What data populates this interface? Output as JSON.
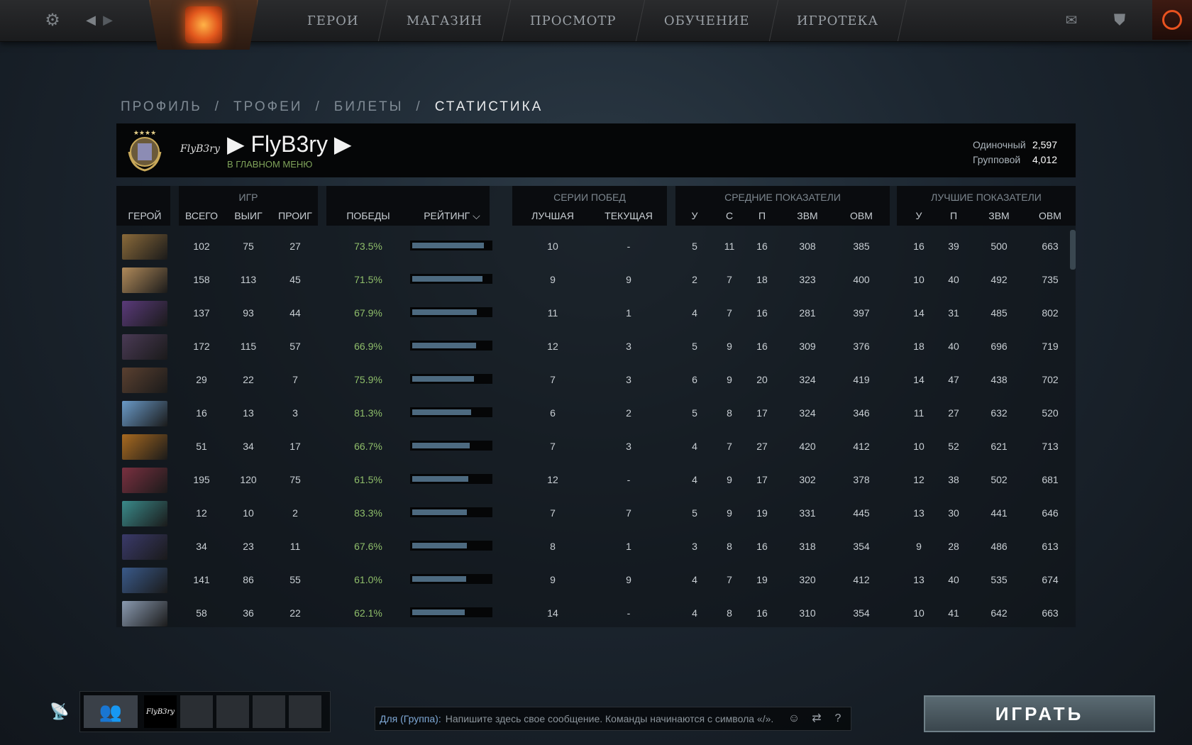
{
  "nav": {
    "items": [
      "ГЕРОИ",
      "МАГАЗИН",
      "ПРОСМОТР",
      "ОБУЧЕНИЕ",
      "ИГРОТЕКА"
    ]
  },
  "breadcrumb": {
    "items": [
      "ПРОФИЛЬ",
      "ТРОФЕИ",
      "БИЛЕТЫ",
      "СТАТИСТИКА"
    ],
    "separator": "/",
    "active": "СТАТИСТИКА"
  },
  "profile": {
    "avatar_text": "FlyB3ry",
    "name": "▶ FlyB3ry ▶",
    "status": "В ГЛАВНОМ МЕНЮ",
    "mmr": [
      {
        "label": "Одиночный",
        "value": "2,597"
      },
      {
        "label": "Групповой",
        "value": "4,012"
      }
    ]
  },
  "table": {
    "groups": {
      "games": "ИГР",
      "streaks": "СЕРИИ ПОБЕД",
      "avg": "СРЕДНИЕ ПОКАЗАТЕЛИ",
      "best": "ЛУЧШИЕ ПОКАЗАТЕЛИ"
    },
    "columns": {
      "hero": "ГЕРОЙ",
      "total": "ВСЕГО",
      "won": "ВЫИГ",
      "lost": "ПРОИГ",
      "winrate": "ПОБЕДЫ",
      "rating": "РЕЙТИНГ ⌵",
      "best_streak": "ЛУЧШАЯ",
      "cur_streak": "ТЕКУЩАЯ",
      "avg_k": "У",
      "avg_d": "С",
      "avg_a": "П",
      "avg_xpm": "ЗВМ",
      "avg_gpm": "ОВМ",
      "best_k": "У",
      "best_a": "П",
      "best_xpm": "ЗВМ",
      "best_gpm": "ОВМ"
    },
    "rows": [
      {
        "hero_color": "#8a6a3a",
        "total": "102",
        "won": "75",
        "lost": "27",
        "winrate": "73.5%",
        "rating": 0.92,
        "best_streak": "10",
        "cur_streak": "-",
        "avg": [
          "5",
          "11",
          "16",
          "308",
          "385"
        ],
        "best": [
          "16",
          "39",
          "500",
          "663"
        ]
      },
      {
        "hero_color": "#b08a5a",
        "total": "158",
        "won": "113",
        "lost": "45",
        "winrate": "71.5%",
        "rating": 0.9,
        "best_streak": "9",
        "cur_streak": "9",
        "avg": [
          "2",
          "7",
          "18",
          "323",
          "400"
        ],
        "best": [
          "10",
          "40",
          "492",
          "735"
        ]
      },
      {
        "hero_color": "#5a3a7a",
        "total": "137",
        "won": "93",
        "lost": "44",
        "winrate": "67.9%",
        "rating": 0.83,
        "best_streak": "11",
        "cur_streak": "1",
        "avg": [
          "4",
          "7",
          "16",
          "281",
          "397"
        ],
        "best": [
          "14",
          "31",
          "485",
          "802"
        ]
      },
      {
        "hero_color": "#4a3a55",
        "total": "172",
        "won": "115",
        "lost": "57",
        "winrate": "66.9%",
        "rating": 0.82,
        "best_streak": "12",
        "cur_streak": "3",
        "avg": [
          "5",
          "9",
          "16",
          "309",
          "376"
        ],
        "best": [
          "18",
          "40",
          "696",
          "719"
        ]
      },
      {
        "hero_color": "#5a4030",
        "total": "29",
        "won": "22",
        "lost": "7",
        "winrate": "75.9%",
        "rating": 0.79,
        "best_streak": "7",
        "cur_streak": "3",
        "avg": [
          "6",
          "9",
          "20",
          "324",
          "419"
        ],
        "best": [
          "14",
          "47",
          "438",
          "702"
        ]
      },
      {
        "hero_color": "#6a9ac8",
        "total": "16",
        "won": "13",
        "lost": "3",
        "winrate": "81.3%",
        "rating": 0.75,
        "best_streak": "6",
        "cur_streak": "2",
        "avg": [
          "5",
          "8",
          "17",
          "324",
          "346"
        ],
        "best": [
          "11",
          "27",
          "632",
          "520"
        ]
      },
      {
        "hero_color": "#a86a20",
        "total": "51",
        "won": "34",
        "lost": "17",
        "winrate": "66.7%",
        "rating": 0.74,
        "best_streak": "7",
        "cur_streak": "3",
        "avg": [
          "4",
          "7",
          "27",
          "420",
          "412"
        ],
        "best": [
          "10",
          "52",
          "621",
          "713"
        ]
      },
      {
        "hero_color": "#7a3040",
        "total": "195",
        "won": "120",
        "lost": "75",
        "winrate": "61.5%",
        "rating": 0.72,
        "best_streak": "12",
        "cur_streak": "-",
        "avg": [
          "4",
          "9",
          "17",
          "302",
          "378"
        ],
        "best": [
          "12",
          "38",
          "502",
          "681"
        ]
      },
      {
        "hero_color": "#3a8a8a",
        "total": "12",
        "won": "10",
        "lost": "2",
        "winrate": "83.3%",
        "rating": 0.7,
        "best_streak": "7",
        "cur_streak": "7",
        "avg": [
          "5",
          "9",
          "19",
          "331",
          "445"
        ],
        "best": [
          "13",
          "30",
          "441",
          "646"
        ]
      },
      {
        "hero_color": "#3a3a6a",
        "total": "34",
        "won": "23",
        "lost": "11",
        "winrate": "67.6%",
        "rating": 0.7,
        "best_streak": "8",
        "cur_streak": "1",
        "avg": [
          "3",
          "8",
          "16",
          "318",
          "354"
        ],
        "best": [
          "9",
          "28",
          "486",
          "613"
        ]
      },
      {
        "hero_color": "#3a5a8a",
        "total": "141",
        "won": "86",
        "lost": "55",
        "winrate": "61.0%",
        "rating": 0.69,
        "best_streak": "9",
        "cur_streak": "9",
        "avg": [
          "4",
          "7",
          "19",
          "320",
          "412"
        ],
        "best": [
          "13",
          "40",
          "535",
          "674"
        ]
      },
      {
        "hero_color": "#8a9ab0",
        "total": "58",
        "won": "36",
        "lost": "22",
        "winrate": "62.1%",
        "rating": 0.67,
        "best_streak": "14",
        "cur_streak": "-",
        "avg": [
          "4",
          "8",
          "16",
          "310",
          "354"
        ],
        "best": [
          "10",
          "41",
          "642",
          "663"
        ]
      }
    ]
  },
  "party": {
    "me_text": "FlyB3ry"
  },
  "chat": {
    "label": "Для (Группа):",
    "placeholder": "Напишите здесь свое сообщение. Команды начинаются с символа «/».",
    "help": "?"
  },
  "play_label": "ИГРАТЬ",
  "icons": {
    "settings": "gear-icon",
    "back": "arrow-left-icon",
    "forward": "arrow-right-icon",
    "mail": "mail-icon",
    "armory": "armory-icon",
    "power": "power-icon"
  }
}
